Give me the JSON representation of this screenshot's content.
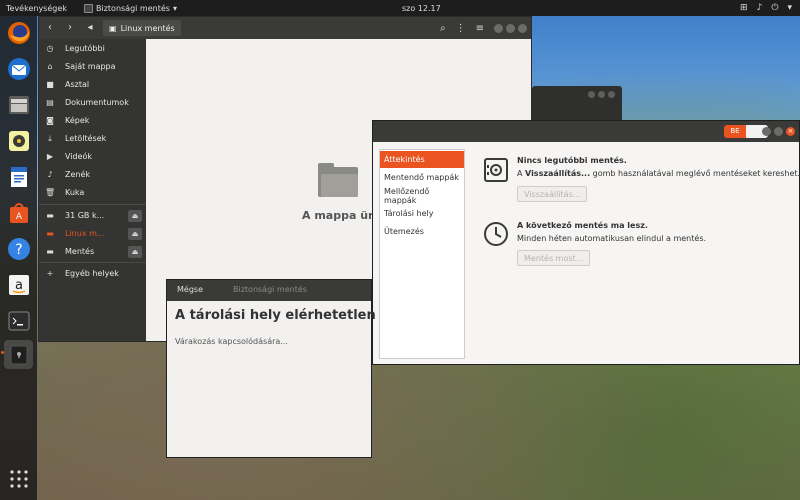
{
  "topbar": {
    "activities": "Tevékenységek",
    "app_name": "Biztonsági mentés",
    "app_arrow": "▾",
    "clock": "szo 12.17",
    "icons": [
      "network-icon",
      "volume-icon",
      "power-icon",
      "arrow-down-icon"
    ]
  },
  "dock": {
    "items": [
      "firefox-icon",
      "thunderbird-icon",
      "files-icon",
      "rhythmbox-icon",
      "writer-icon",
      "software-icon",
      "help-icon",
      "amazon-icon",
      "terminal-icon",
      "backup-icon",
      "app-grid-icon"
    ]
  },
  "files": {
    "path_label": "Linux mentés",
    "sidebar": [
      {
        "icon": "clock-icon",
        "label": "Legutóbbi"
      },
      {
        "icon": "home-icon",
        "label": "Saját mappa"
      },
      {
        "icon": "folder-icon",
        "label": "Asztal"
      },
      {
        "icon": "document-icon",
        "label": "Dokumentumok"
      },
      {
        "icon": "camera-icon",
        "label": "Képek"
      },
      {
        "icon": "download-icon",
        "label": "Letöltések"
      },
      {
        "icon": "video-icon",
        "label": "Videók"
      },
      {
        "icon": "music-icon",
        "label": "Zenék"
      },
      {
        "icon": "trash-icon",
        "label": "Kuka"
      },
      {
        "icon": "drive-icon",
        "label": "31 GB k..."
      },
      {
        "icon": "drive-icon",
        "label": "Linux m..."
      },
      {
        "icon": "drive-icon",
        "label": "Mentés"
      },
      {
        "icon": "plus-icon",
        "label": "Egyéb helyek"
      }
    ],
    "empty_text": "A mappa üre"
  },
  "backup": {
    "toggle_label": "BE",
    "nav": [
      "Áttekintés",
      "Mentendő mappák",
      "Mellőzendő mappák",
      "Tárolási hely",
      "Ütemezés"
    ],
    "last_backup": {
      "title": "Nincs legutóbbi mentés.",
      "desc_prefix": "A ",
      "desc_bold": "Visszaállítás...",
      "desc_suffix": " gomb használatával meglévő mentéseket kereshet.",
      "button": "Visszaállítás..."
    },
    "next_backup": {
      "title": "A következő mentés ma lesz.",
      "desc": "Minden héten automatikusan elindul a mentés.",
      "button": "Mentés most..."
    }
  },
  "dialog": {
    "cancel": "Mégse",
    "title": "Biztonsági mentés",
    "heading": "A tárolási hely elérhetetlen",
    "subtext": "Várakozás kapcsolódására..."
  }
}
